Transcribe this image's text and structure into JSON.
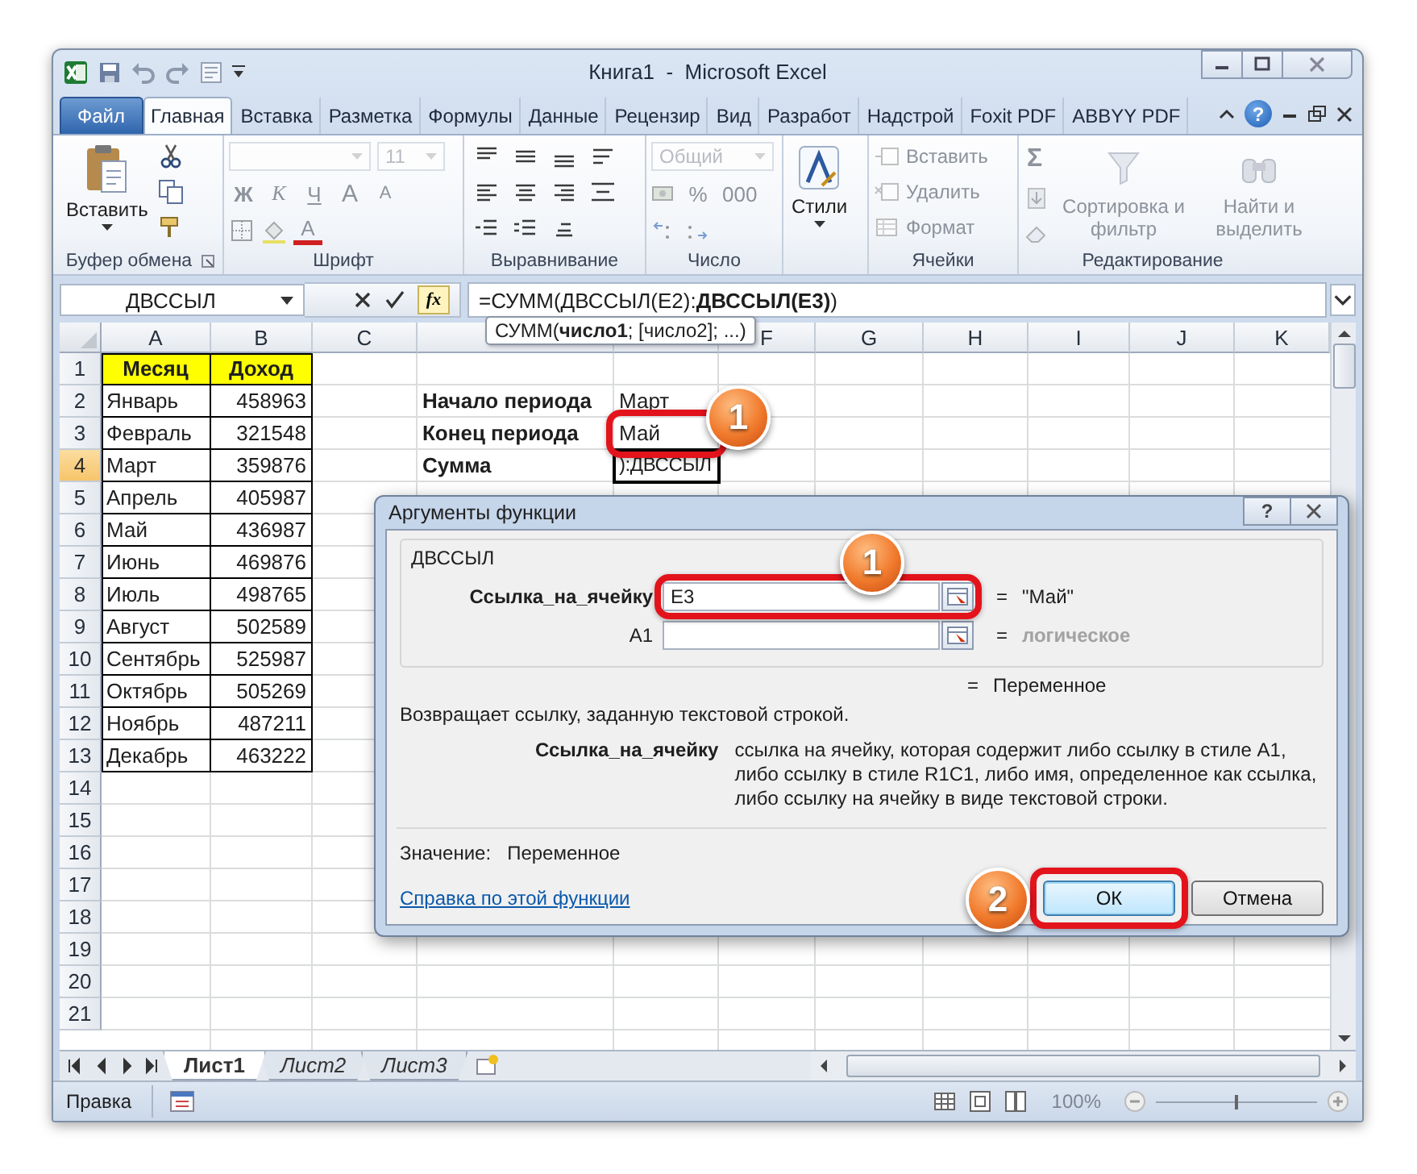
{
  "window": {
    "title": "Книга1  -  Microsoft Excel"
  },
  "ribbon_tabs": [
    {
      "label": "Файл",
      "kind": "file",
      "selected": false
    },
    {
      "label": "Главная",
      "kind": "tab",
      "selected": true
    },
    {
      "label": "Вставка",
      "kind": "tab",
      "selected": false
    },
    {
      "label": "Разметка",
      "kind": "tab",
      "selected": false
    },
    {
      "label": "Формулы",
      "kind": "tab",
      "selected": false
    },
    {
      "label": "Данные",
      "kind": "tab",
      "selected": false
    },
    {
      "label": "Рецензир",
      "kind": "tab",
      "selected": false
    },
    {
      "label": "Вид",
      "kind": "tab",
      "selected": false
    },
    {
      "label": "Разработ",
      "kind": "tab",
      "selected": false
    },
    {
      "label": "Надстрой",
      "kind": "tab",
      "selected": false
    },
    {
      "label": "Foxit PDF",
      "kind": "tab",
      "selected": false
    },
    {
      "label": "ABBYY PDF",
      "kind": "tab",
      "selected": false
    }
  ],
  "ribbon_help": "?",
  "ribbon": {
    "clipboard": {
      "label": "Буфер обмена",
      "paste": "Вставить",
      "disabled": false
    },
    "font": {
      "label": "Шрифт",
      "size": "11",
      "bold": "Ж",
      "italic": "К",
      "underline": "Ч",
      "grow": "A",
      "shrink": "A",
      "color_letter": "A",
      "disabled": true
    },
    "alignment": {
      "label": "Выравнивание",
      "disabled": false
    },
    "number": {
      "label": "Число",
      "format": "Общий",
      "percent": "%",
      "thousands": "000",
      "disabled": true
    },
    "styles": {
      "button": "Стили",
      "disabled": false
    },
    "cells": {
      "label": "Ячейки",
      "insert": "Вставить",
      "delete": "Удалить",
      "format": "Формат",
      "disabled": true
    },
    "editing": {
      "label": "Редактирование",
      "sum": "Σ",
      "sort": "Сортировка и фильтр",
      "find": "Найти и выделить",
      "disabled": true
    }
  },
  "formula_bar": {
    "name_box": "ДВССЫЛ",
    "function_button": "fx",
    "formula": "=СУММ(ДВССЫЛ(E2):**ДВССЫЛ(E3)**)"
  },
  "tooltip": "СУММ(**число1**; [число2]; ...)",
  "grid": {
    "columns": [
      {
        "label": "A"
      },
      {
        "label": "B"
      },
      {
        "label": "C"
      },
      {},
      {},
      {
        "label": "F"
      },
      {
        "label": "G"
      },
      {
        "label": "H"
      },
      {
        "label": "I"
      },
      {
        "label": "J"
      },
      {
        "label": "K"
      }
    ],
    "rows": [
      {
        "number": "1",
        "selected": false,
        "kind": "header",
        "a": "Месяц",
        "b": "Доход"
      },
      {
        "number": "2",
        "selected": false,
        "kind": "data",
        "a": "Январь",
        "b": "458963",
        "d": "Начало периода",
        "e": {
          "text": "Март",
          "active": false
        }
      },
      {
        "number": "3",
        "selected": false,
        "kind": "data",
        "a": "Февраль",
        "b": "321548",
        "d": "Конец периода",
        "e": {
          "text": "Май",
          "active": false,
          "callout": "1"
        }
      },
      {
        "number": "4",
        "selected": true,
        "kind": "data",
        "a": "Март",
        "b": "359876",
        "d": "Сумма",
        "e": {
          "text": "):ДВССЫЛ",
          "active": true
        }
      },
      {
        "number": "5",
        "selected": false,
        "kind": "data",
        "a": "Апрель",
        "b": "405987"
      },
      {
        "number": "6",
        "selected": false,
        "kind": "data",
        "a": "Май",
        "b": "436987"
      },
      {
        "number": "7",
        "selected": false,
        "kind": "data",
        "a": "Июнь",
        "b": "469876"
      },
      {
        "number": "8",
        "selected": false,
        "kind": "data",
        "a": "Июль",
        "b": "498765"
      },
      {
        "number": "9",
        "selected": false,
        "kind": "data",
        "a": "Август",
        "b": "502589"
      },
      {
        "number": "10",
        "selected": false,
        "kind": "data",
        "a": "Сентябрь",
        "b": "525987"
      },
      {
        "number": "11",
        "selected": false,
        "kind": "data",
        "a": "Октябрь",
        "b": "505269"
      },
      {
        "number": "12",
        "selected": false,
        "kind": "data",
        "a": "Ноябрь",
        "b": "487211"
      },
      {
        "number": "13",
        "selected": false,
        "kind": "data",
        "a": "Декабрь",
        "b": "463222"
      },
      {
        "number": "14",
        "selected": false,
        "kind": "empty"
      },
      {
        "number": "15",
        "selected": false,
        "kind": "empty"
      },
      {
        "number": "16",
        "selected": false,
        "kind": "empty"
      },
      {
        "number": "17",
        "selected": false,
        "kind": "empty"
      },
      {
        "number": "18",
        "selected": false,
        "kind": "empty"
      },
      {
        "number": "19",
        "selected": false,
        "kind": "empty"
      },
      {
        "number": "20",
        "selected": false,
        "kind": "empty"
      },
      {
        "number": "21",
        "selected": false,
        "kind": "empty"
      }
    ]
  },
  "dialog": {
    "title": "Аргументы функции",
    "help": "?",
    "function_name": "ДВССЫЛ",
    "arguments": [
      {
        "name": "Ссылка_на_ячейку",
        "value": "E3",
        "sign": "=",
        "result": "\"Май\"",
        "required": true,
        "greyed": false,
        "callout": "1"
      },
      {
        "name": "A1",
        "sign": "=",
        "result": "логическое",
        "required": false,
        "greyed": true
      }
    ],
    "formula_result": {
      "sign": "=",
      "text": "Переменное"
    },
    "description": "Возвращает ссылку, заданную текстовой строкой.",
    "argument_help": {
      "name": "Ссылка_на_ячейку",
      "text": "ссылка на ячейку, которая содержит либо ссылку в стиле A1, либо ссылку в стиле R1C1, либо имя, определенное как ссылка, либо ссылку на ячейку в виде текстовой строки."
    },
    "value_label": "Значение:",
    "value": "Переменное",
    "help_link": "Справка по этой функции",
    "buttons": [
      {
        "label": "ОК",
        "default": true,
        "callout": "2"
      },
      {
        "label": "Отмена",
        "default": false
      }
    ]
  },
  "sheet_tabs": [
    {
      "label": "Лист1",
      "selected": true
    },
    {
      "label": "Лист2",
      "selected": false
    },
    {
      "label": "Лист3",
      "selected": false
    }
  ],
  "status_bar": {
    "mode": "Правка",
    "zoom": "100%",
    "zoom_slider": {
      "level": 0.5
    }
  }
}
